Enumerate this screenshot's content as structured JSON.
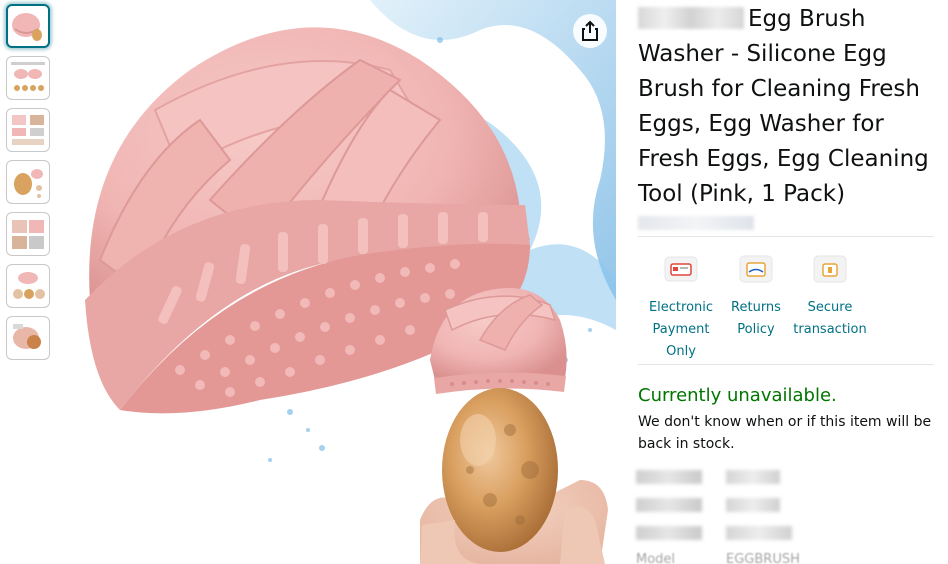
{
  "thumbnails": [
    {
      "name": "thumb-1",
      "selected": true
    },
    {
      "name": "thumb-2",
      "selected": false
    },
    {
      "name": "thumb-3",
      "selected": false
    },
    {
      "name": "thumb-4",
      "selected": false
    },
    {
      "name": "thumb-5",
      "selected": false
    },
    {
      "name": "thumb-6",
      "selected": false
    },
    {
      "name": "thumb-7",
      "selected": false
    }
  ],
  "product": {
    "title": "Egg Brush Washer - Silicone Egg Brush for Cleaning Fresh Eggs, Egg Washer for Fresh Eggs, Egg Cleaning Tool (Pink, 1 Pack)"
  },
  "features": [
    {
      "label": "Electronic Payment Only",
      "icon": "payment-card-icon"
    },
    {
      "label": "Returns Policy",
      "icon": "returns-box-icon"
    },
    {
      "label": "Secure transaction",
      "icon": "secure-lock-icon"
    }
  ],
  "availability": {
    "status": "Currently unavailable.",
    "note": "We don't know when or if this item will be back in stock."
  },
  "specs": {
    "last_key": "Model",
    "last_val": "EGGBRUSH"
  },
  "colors": {
    "link": "#007185",
    "available_green": "#007600",
    "product_pink": "#f0b7b6"
  },
  "icons": {
    "share": "share-icon"
  }
}
